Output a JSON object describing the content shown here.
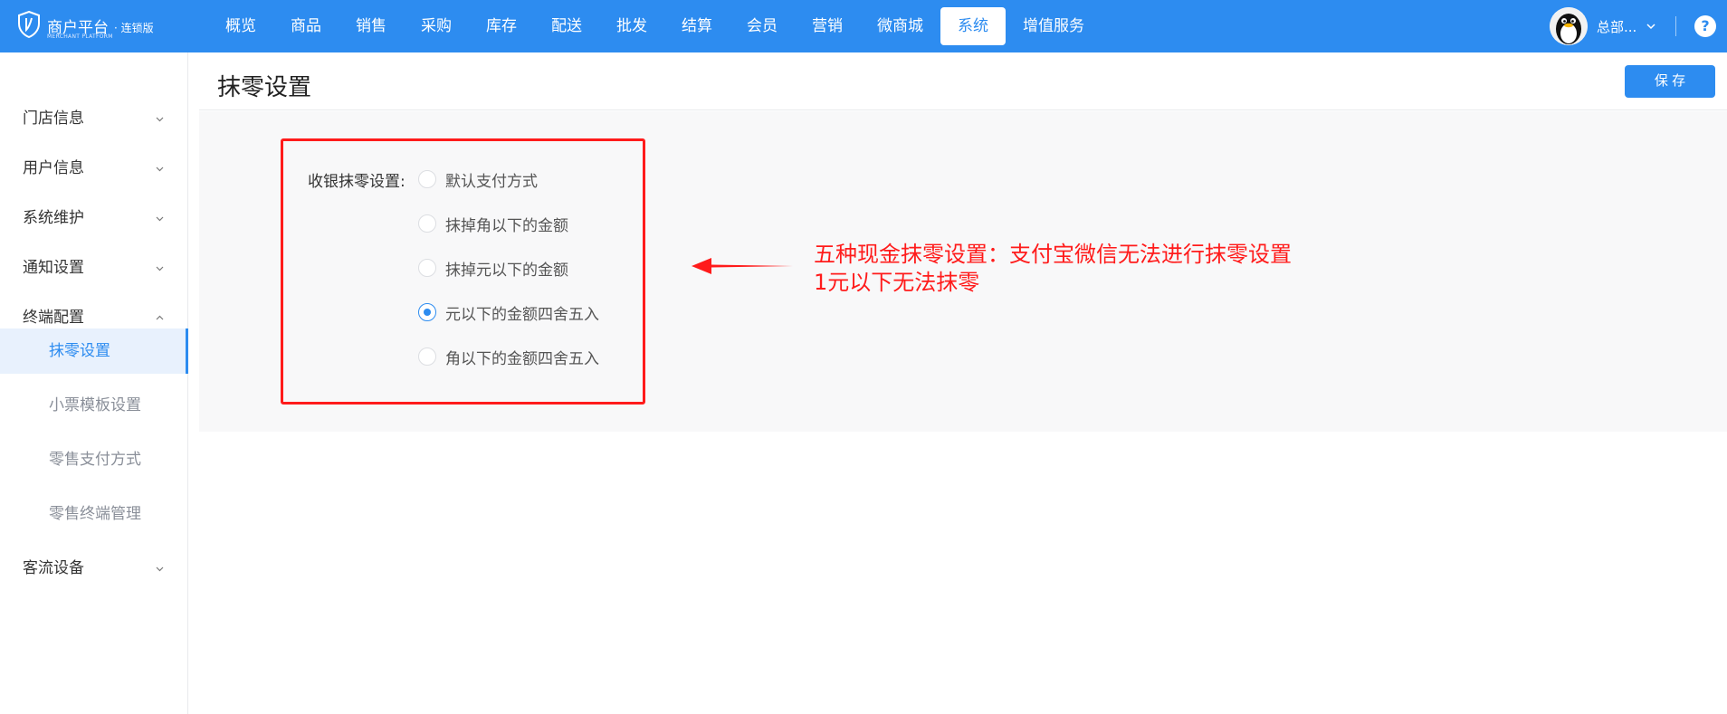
{
  "header": {
    "logo_title": "商户平台",
    "logo_subtitle": "MERCHANT PLATFORM",
    "logo_edition": "· 连锁版",
    "nav": [
      {
        "label": "概览"
      },
      {
        "label": "商品"
      },
      {
        "label": "销售"
      },
      {
        "label": "采购"
      },
      {
        "label": "库存"
      },
      {
        "label": "配送"
      },
      {
        "label": "批发"
      },
      {
        "label": "结算"
      },
      {
        "label": "会员"
      },
      {
        "label": "营销"
      },
      {
        "label": "微商城"
      },
      {
        "label": "系统",
        "active": true
      },
      {
        "label": "增值服务"
      }
    ],
    "user_name": "总部...",
    "help_label": "?"
  },
  "sidebar": {
    "groups": [
      {
        "label": "门店信息",
        "expanded": false
      },
      {
        "label": "用户信息",
        "expanded": false
      },
      {
        "label": "系统维护",
        "expanded": false
      },
      {
        "label": "通知设置",
        "expanded": false
      },
      {
        "label": "终端配置",
        "expanded": true
      },
      {
        "label": "客流设备",
        "expanded": false
      }
    ],
    "sub_items": [
      {
        "label": "抹零设置",
        "active": true
      },
      {
        "label": "小票模板设置"
      },
      {
        "label": "零售支付方式"
      },
      {
        "label": "零售终端管理"
      }
    ]
  },
  "main": {
    "page_title": "抹零设置",
    "save_label": "保 存",
    "form_label": "收银抹零设置:",
    "options": [
      {
        "label": "默认支付方式",
        "checked": false
      },
      {
        "label": "抹掉角以下的金额",
        "checked": false
      },
      {
        "label": "抹掉元以下的金额",
        "checked": false
      },
      {
        "label": "元以下的金额四舍五入",
        "checked": true
      },
      {
        "label": "角以下的金额四舍五入",
        "checked": false
      }
    ]
  },
  "annotation": {
    "line1": "五种现金抹零设置：支付宝微信无法进行抹零设置",
    "line2": "1元以下无法抹零",
    "color": "#ff1b1b"
  },
  "colors": {
    "primary": "#2d8cf0",
    "active_bg": "#e8f1fd",
    "panel_bg": "#f8f8f9"
  }
}
